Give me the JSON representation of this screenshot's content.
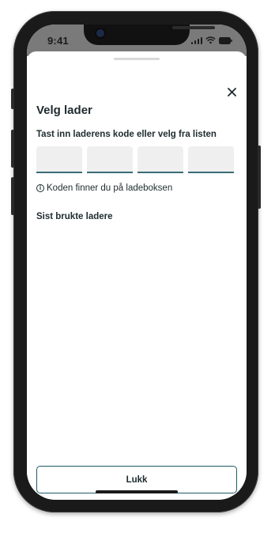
{
  "status_bar": {
    "time": "9:41"
  },
  "sheet": {
    "title": "Velg lader",
    "code_instruction": "Tast inn laderens kode eller velg fra listen",
    "code_boxes": [
      "",
      "",
      "",
      ""
    ],
    "hint": "Koden finner du på ladeboksen",
    "recent_section_title": "Sist brukte ladere",
    "close_button_label": "Lukk"
  },
  "icons": {
    "close": "close-icon",
    "info": "info-icon"
  },
  "colors": {
    "accent": "#1f5a66",
    "text": "#1e2b2e",
    "input_bg": "#efefef"
  }
}
